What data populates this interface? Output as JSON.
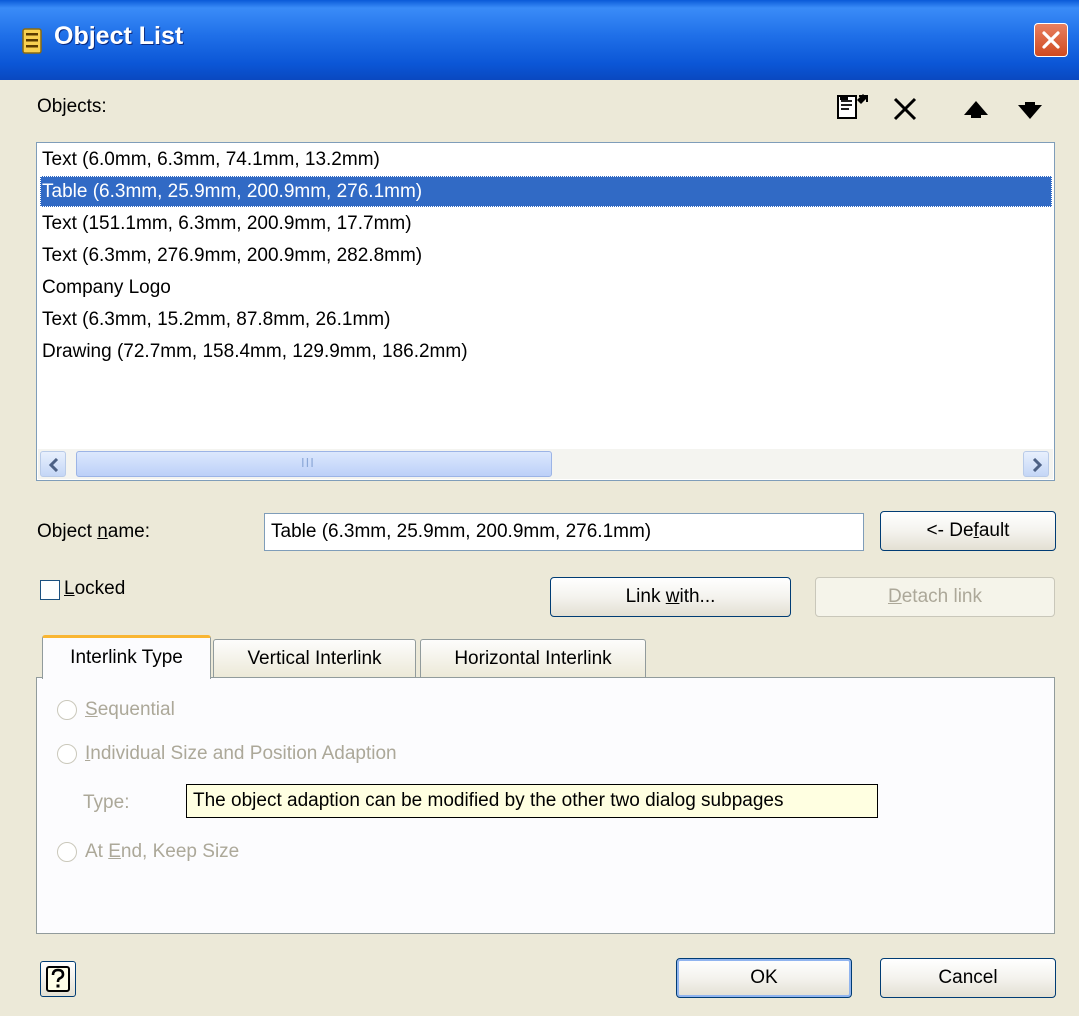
{
  "window": {
    "title": "Object List"
  },
  "objects": {
    "label": "Objects:",
    "items": [
      "Text (6.0mm, 6.3mm, 74.1mm, 13.2mm)",
      "Table (6.3mm, 25.9mm, 200.9mm, 276.1mm)",
      "Text (151.1mm, 6.3mm, 200.9mm, 17.7mm)",
      "Text (6.3mm, 276.9mm, 200.9mm, 282.8mm)",
      "Company Logo",
      "Text (6.3mm, 15.2mm, 87.8mm, 26.1mm)",
      "Drawing (72.7mm, 158.4mm, 129.9mm, 186.2mm)"
    ],
    "selected_index": 1,
    "scroll_thumb_glyph": "III"
  },
  "object_name": {
    "label_prefix": "Object ",
    "label_mnemonic": "n",
    "label_suffix": "ame:",
    "value": "Table (6.3mm, 25.9mm, 200.9mm, 276.1mm)",
    "default_prefix": "<- De",
    "default_mnemonic": "f",
    "default_suffix": "ault"
  },
  "locked": {
    "mnemonic": "L",
    "rest": "ocked",
    "checked": false
  },
  "link": {
    "with_prefix": "Link ",
    "with_mnemonic": "w",
    "with_suffix": "ith...",
    "detach_mnemonic": "D",
    "detach_rest": "etach link"
  },
  "tabs": [
    "Interlink Type",
    "Vertical Interlink",
    "Horizontal Interlink"
  ],
  "active_tab": 0,
  "interlink": {
    "sequential_mnemonic": "S",
    "sequential_rest": "equential",
    "individual_mnemonic": "I",
    "individual_rest": "ndividual Size and Position Adaption",
    "type_label": "Type:",
    "at_end_prefix": "At ",
    "at_end_mnemonic": "E",
    "at_end_suffix": "nd, Keep Size"
  },
  "tooltip": "The object adaption can be modified by the other two dialog subpages",
  "footer": {
    "help_glyph": "?",
    "ok": "OK",
    "cancel": "Cancel"
  },
  "colors": {
    "selection": "#316ac5",
    "titlebar": "#0a5ad8",
    "dialog_bg": "#ece9d8",
    "tooltip_bg": "#ffffe1",
    "tab_highlight": "#f9b633"
  },
  "icons": [
    "object-list-icon",
    "close-icon",
    "properties-icon",
    "delete-icon",
    "move-up-icon",
    "move-down-icon",
    "scroll-left-icon",
    "scroll-right-icon",
    "help-icon"
  ]
}
